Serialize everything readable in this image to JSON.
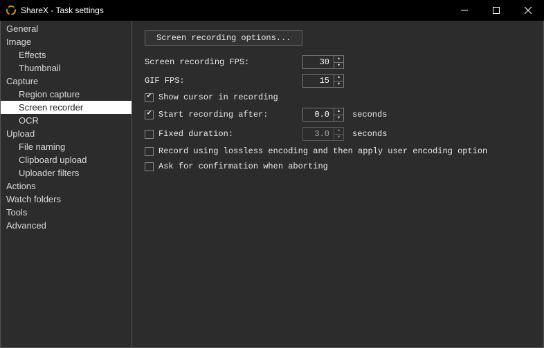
{
  "window": {
    "title": "ShareX - Task settings"
  },
  "sidebar": {
    "items": [
      {
        "label": "General",
        "child": false
      },
      {
        "label": "Image",
        "child": false
      },
      {
        "label": "Effects",
        "child": true
      },
      {
        "label": "Thumbnail",
        "child": true
      },
      {
        "label": "Capture",
        "child": false
      },
      {
        "label": "Region capture",
        "child": true
      },
      {
        "label": "Screen recorder",
        "child": true,
        "selected": true
      },
      {
        "label": "OCR",
        "child": true
      },
      {
        "label": "Upload",
        "child": false
      },
      {
        "label": "File naming",
        "child": true
      },
      {
        "label": "Clipboard upload",
        "child": true
      },
      {
        "label": "Uploader filters",
        "child": true
      },
      {
        "label": "Actions",
        "child": false
      },
      {
        "label": "Watch folders",
        "child": false
      },
      {
        "label": "Tools",
        "child": false
      },
      {
        "label": "Advanced",
        "child": false
      }
    ]
  },
  "main": {
    "options_button": "Screen recording options...",
    "fps_label": "Screen recording FPS:",
    "fps_value": "30",
    "gif_fps_label": "GIF FPS:",
    "gif_fps_value": "15",
    "show_cursor_label": "Show cursor in recording",
    "show_cursor_checked": true,
    "start_after_label": "Start recording after:",
    "start_after_checked": true,
    "start_after_value": "0.0",
    "seconds_unit": "seconds",
    "fixed_duration_label": "Fixed duration:",
    "fixed_duration_checked": false,
    "fixed_duration_value": "3.0",
    "lossless_label": "Record using lossless encoding and then apply user encoding option",
    "lossless_checked": false,
    "ask_confirm_label": "Ask for confirmation when aborting",
    "ask_confirm_checked": false
  }
}
